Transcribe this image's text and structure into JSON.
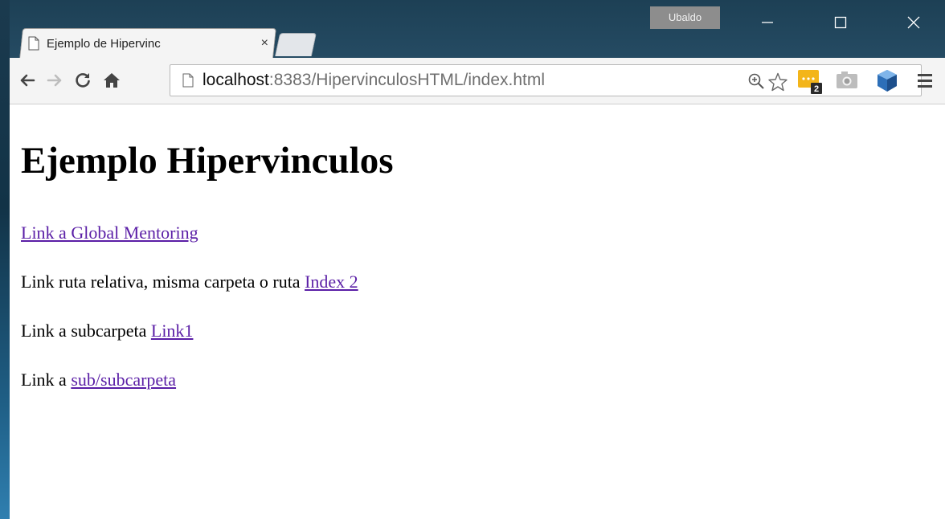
{
  "browser": {
    "profile_name": "Ubaldo",
    "tab": {
      "title": "Ejemplo de Hipervinc",
      "close_glyph": "×"
    },
    "url": {
      "host": "localhost",
      "rest": ":8383/HipervinculosHTML/index.html"
    },
    "extensions": [
      {
        "name": "notes-extension-icon",
        "badge": "2"
      },
      {
        "name": "camera-extension-icon"
      },
      {
        "name": "box-extension-icon"
      }
    ]
  },
  "page": {
    "heading": "Ejemplo Hipervinculos",
    "paragraphs": [
      {
        "prefix": "",
        "link": "Link a Global Mentoring"
      },
      {
        "prefix": "Link ruta relativa, misma carpeta o ruta ",
        "link": "Index 2"
      },
      {
        "prefix": "Link a subcarpeta ",
        "link": "Link1"
      },
      {
        "prefix": "Link a ",
        "link": "sub/subcarpeta"
      }
    ]
  },
  "colors": {
    "link": "#5a1ea6",
    "titlebar": "#1d4055",
    "profile_badge": "#8d8d8d"
  }
}
